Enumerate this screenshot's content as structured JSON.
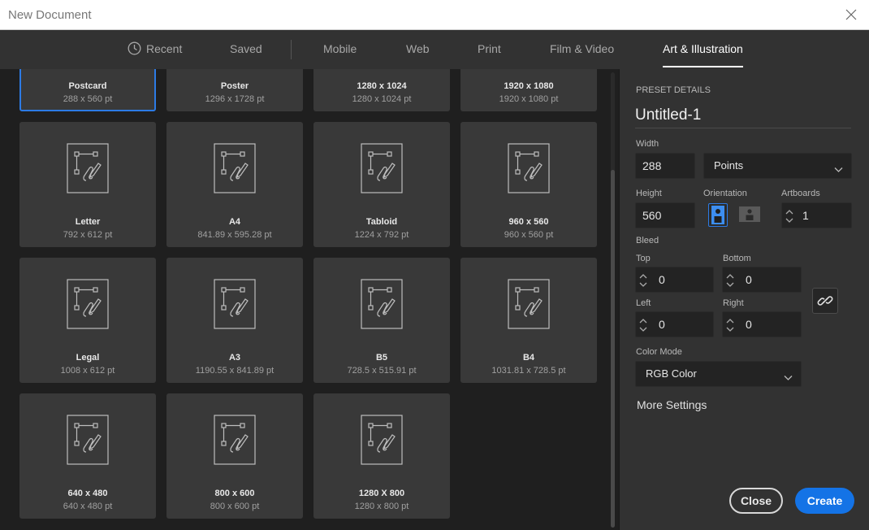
{
  "window": {
    "title": "New Document"
  },
  "tabs": [
    {
      "label": "Recent",
      "icon": "clock-icon"
    },
    {
      "label": "Saved"
    },
    {
      "label": "Mobile"
    },
    {
      "label": "Web"
    },
    {
      "label": "Print"
    },
    {
      "label": "Film & Video"
    },
    {
      "label": "Art & Illustration",
      "active": true
    }
  ],
  "presets": [
    {
      "name": "Postcard",
      "size": "288 x 560 pt",
      "selected": true
    },
    {
      "name": "Poster",
      "size": "1296 x 1728 pt"
    },
    {
      "name": "1280 x 1024",
      "size": "1280 x 1024 pt"
    },
    {
      "name": "1920 x 1080",
      "size": "1920 x 1080 pt"
    },
    {
      "name": "Letter",
      "size": "792 x 612 pt"
    },
    {
      "name": "A4",
      "size": "841.89 x 595.28 pt"
    },
    {
      "name": "Tabloid",
      "size": "1224 x 792 pt"
    },
    {
      "name": "960 x 560",
      "size": "960 x 560 pt"
    },
    {
      "name": "Legal",
      "size": "1008 x 612 pt"
    },
    {
      "name": "A3",
      "size": "1190.55 x 841.89 pt"
    },
    {
      "name": "B5",
      "size": "728.5 x 515.91 pt"
    },
    {
      "name": "B4",
      "size": "1031.81 x 728.5 pt"
    },
    {
      "name": "640 x 480",
      "size": "640 x 480 pt"
    },
    {
      "name": "800 x 600",
      "size": "800 x 600 pt"
    },
    {
      "name": "1280 X 800",
      "size": "1280 x 800 pt"
    }
  ],
  "details": {
    "header": "PRESET DETAILS",
    "doc_name": "Untitled-1",
    "width_label": "Width",
    "width": "288",
    "units": "Points",
    "height_label": "Height",
    "height": "560",
    "orientation_label": "Orientation",
    "orientation": "portrait",
    "artboards_label": "Artboards",
    "artboards": "1",
    "bleed_label": "Bleed",
    "top_label": "Top",
    "top": "0",
    "bottom_label": "Bottom",
    "bottom": "0",
    "left_label": "Left",
    "left": "0",
    "right_label": "Right",
    "right": "0",
    "color_mode_label": "Color Mode",
    "color_mode": "RGB Color",
    "more_settings": "More Settings"
  },
  "buttons": {
    "close": "Close",
    "create": "Create"
  },
  "colors": {
    "accent": "#1473e6",
    "selected_border": "#2c7be5"
  }
}
